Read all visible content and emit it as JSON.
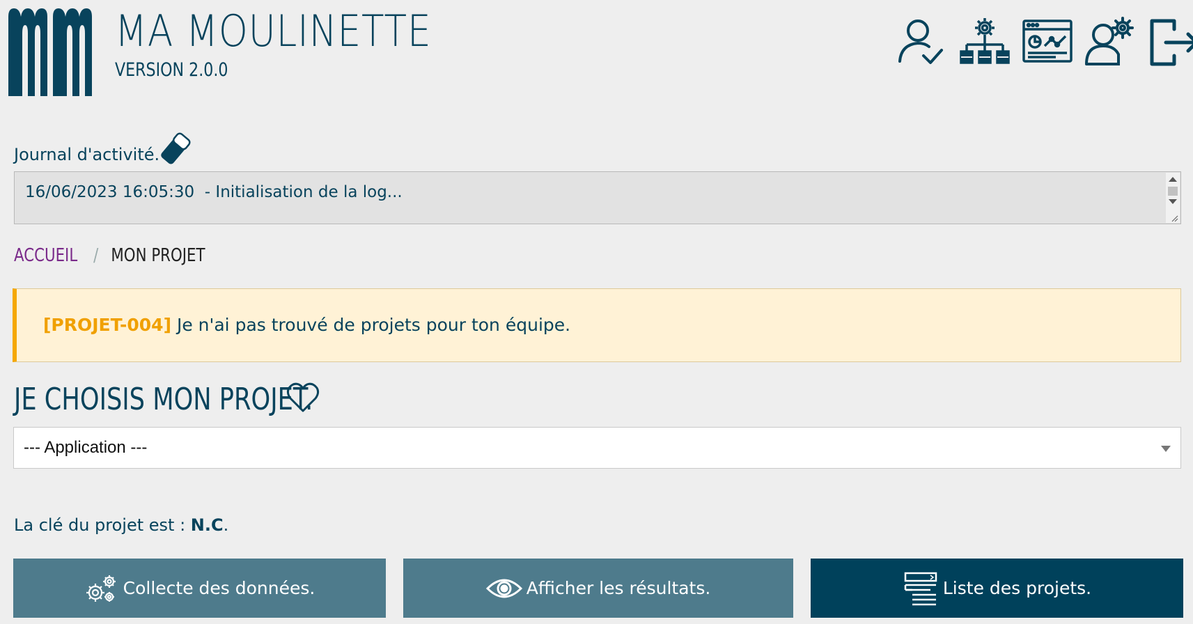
{
  "header": {
    "title": "MA MOULINETTE",
    "version": "VERSION 2.0.0",
    "logo_icon": "mm-logo-icon",
    "icons": [
      "user-check-icon",
      "hierarchy-gear-icon",
      "dashboard-window-icon",
      "user-settings-icon",
      "logout-icon"
    ]
  },
  "journal": {
    "label": "Journal d'activité.",
    "log": "16/06/2023 16:05:30  - Initialisation de la log..."
  },
  "breadcrumb": {
    "home": "ACCUEIL",
    "separator": "/",
    "current": "MON PROJET"
  },
  "alert": {
    "code": "[PROJET-004]",
    "message": " Je n'ai pas trouvé de projets pour ton équipe."
  },
  "choose": {
    "title": "JE CHOISIS MON PROJET.",
    "select_value": "--- Application ---"
  },
  "project_key": {
    "prefix": "La clé du projet est : ",
    "value": "N.C",
    "suffix": "."
  },
  "buttons": {
    "collect": "Collecte des données.",
    "show": "Afficher les résultats.",
    "list": "Liste des projets."
  },
  "colors": {
    "primary": "#00415b",
    "button_muted": "#4e7b8c",
    "alert_bg": "#fff2d6",
    "alert_accent": "#f5a800",
    "breadcrumb_link": "#7a2a8a",
    "background": "#eeeeee"
  }
}
